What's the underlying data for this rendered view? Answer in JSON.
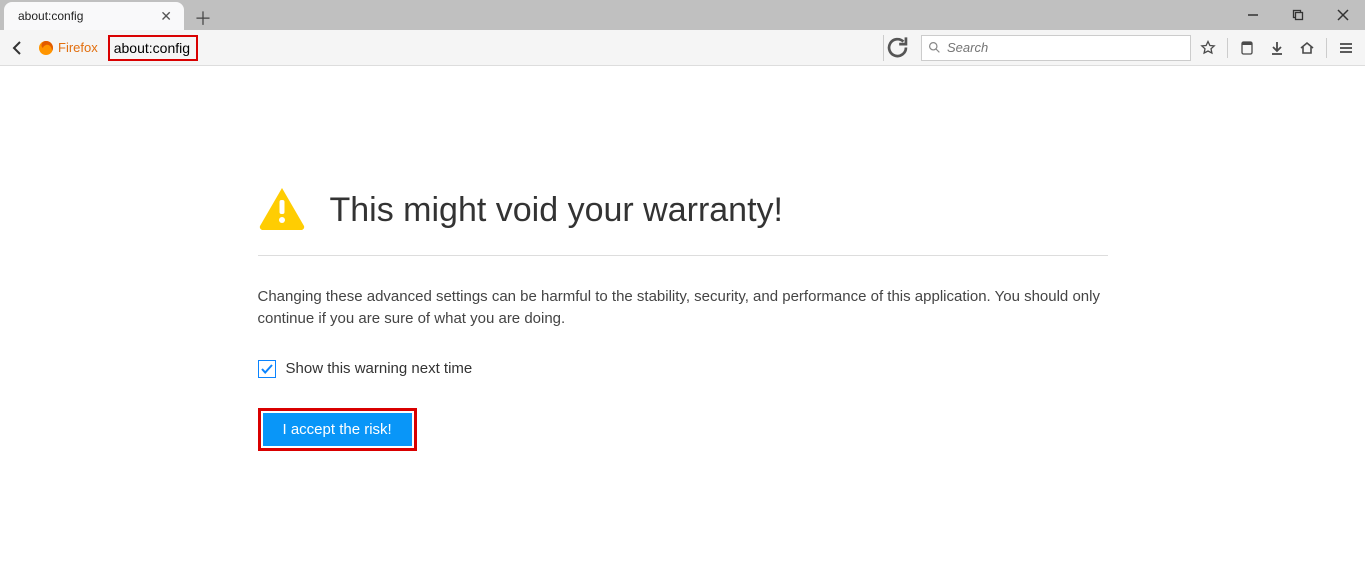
{
  "tab": {
    "title": "about:config"
  },
  "toolbar": {
    "identity_label": "Firefox",
    "url_value": "about:config",
    "search_placeholder": "Search"
  },
  "warning": {
    "title": "This might void your warranty!",
    "body": "Changing these advanced settings can be harmful to the stability, security, and performance of this application. You should only continue if you are sure of what you are doing.",
    "checkbox_label": "Show this warning next time",
    "checkbox_checked": true,
    "accept_label": "I accept the risk!"
  }
}
